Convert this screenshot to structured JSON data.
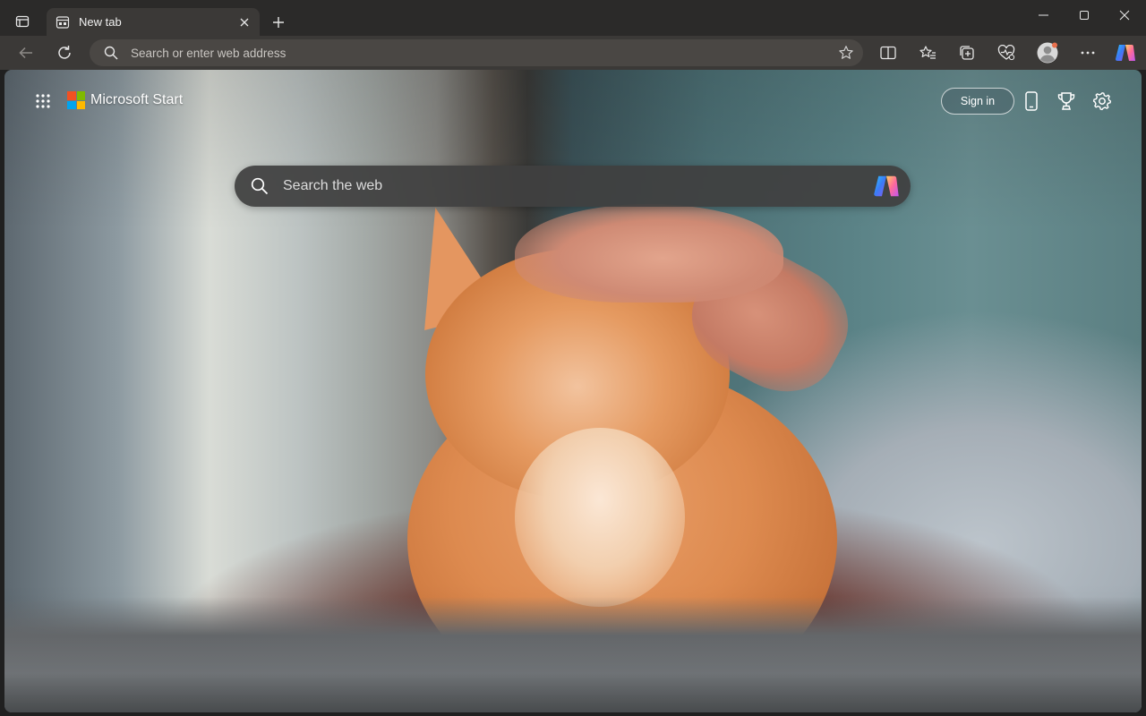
{
  "browser": {
    "tab": {
      "title": "New tab"
    },
    "address_bar": {
      "placeholder": "Search or enter web address"
    }
  },
  "page": {
    "brand": {
      "name": "Microsoft Start",
      "logo_colors": [
        "#f25022",
        "#7fba00",
        "#00a4ef",
        "#ffb900"
      ]
    },
    "header": {
      "sign_in_label": "Sign in"
    },
    "search": {
      "placeholder": "Search the web"
    }
  },
  "colors": {
    "titlebar": "#2b2a29",
    "toolbar": "#3b3937",
    "address_bar": "#4a4744",
    "copilot_gradient": [
      "#2ec5ff",
      "#8b5cf6",
      "#ff6a9a",
      "#ffd166"
    ]
  },
  "icons": {
    "tab_actions": "tab-actions-icon",
    "tab_favicon": "new-tab-page-icon",
    "tab_close": "close-icon",
    "new_tab": "plus-icon",
    "back": "back-arrow-icon",
    "refresh": "refresh-icon",
    "search": "search-icon",
    "favorite_star": "star-icon",
    "split_screen": "split-screen-icon",
    "favorites": "favorites-icon",
    "collections": "collections-icon",
    "browser_essentials": "heart-pulse-icon",
    "profile": "profile-avatar-icon",
    "more": "ellipsis-icon",
    "copilot": "copilot-icon",
    "apps": "app-launcher-icon",
    "phone": "phone-icon",
    "rewards": "rewards-trophy-icon",
    "settings": "gear-icon"
  }
}
